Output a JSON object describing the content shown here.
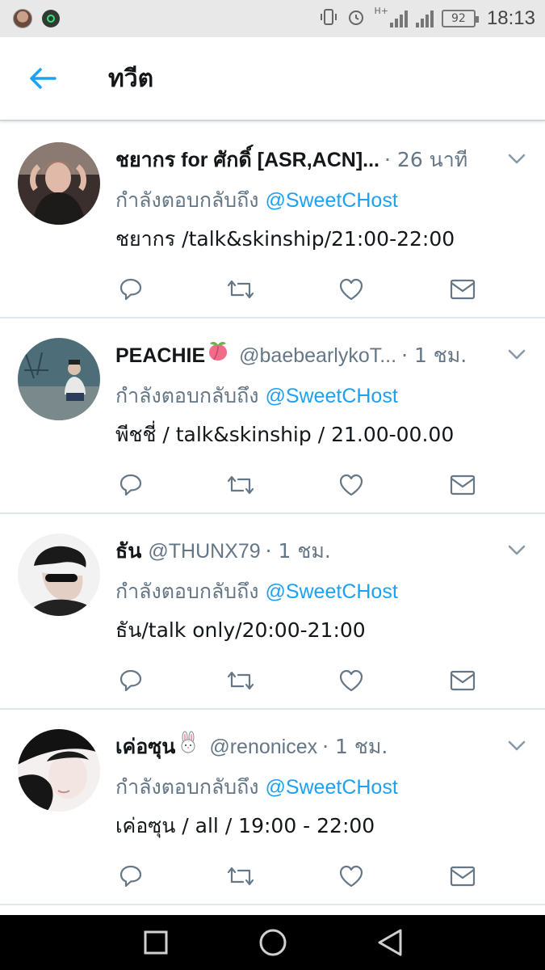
{
  "status_bar": {
    "battery": "92",
    "time": "18:13",
    "network": "H+"
  },
  "header": {
    "back_icon": "arrow-left-icon",
    "title": "ทวีต"
  },
  "colors": {
    "accent": "#1da1f2",
    "secondary_text": "#657786",
    "divider": "#e1e8ed"
  },
  "tweets": [
    {
      "name": "ชยากร for ศักดิ์ [ASR,ACN]...",
      "name_emoji": "",
      "handle": "",
      "time": "· 26 นาที",
      "reply_prefix": "กำลังตอบกลับถึง",
      "reply_to": "@SweetCHost",
      "text": "ชยากร /talk&skinship/21:00-22:00"
    },
    {
      "name": "PEACHIE",
      "name_emoji": "peach-emoji",
      "handle": "@baebearlykoT...",
      "time": "· 1 ชม.",
      "reply_prefix": "กำลังตอบกลับถึง",
      "reply_to": "@SweetCHost",
      "text": "พีชชี่ / talk&skinship / 21.00-00.00"
    },
    {
      "name": "ธัน",
      "name_emoji": "",
      "handle": "@THUNX79",
      "time": "· 1 ชม.",
      "reply_prefix": "กำลังตอบกลับถึง",
      "reply_to": "@SweetCHost",
      "text": "ธัน/talk only/20:00-21:00"
    },
    {
      "name": "เค่อซุน",
      "name_emoji": "rabbit-emoji",
      "handle": "@renonicex",
      "time": "· 1 ชม.",
      "reply_prefix": "กำลังตอบกลับถึง",
      "reply_to": "@SweetCHost",
      "text": "เค่อซุน / all / 19:00 - 22:00"
    }
  ],
  "nav": {
    "recents_icon": "square-icon",
    "home_icon": "circle-icon",
    "back_icon": "triangle-back-icon"
  }
}
